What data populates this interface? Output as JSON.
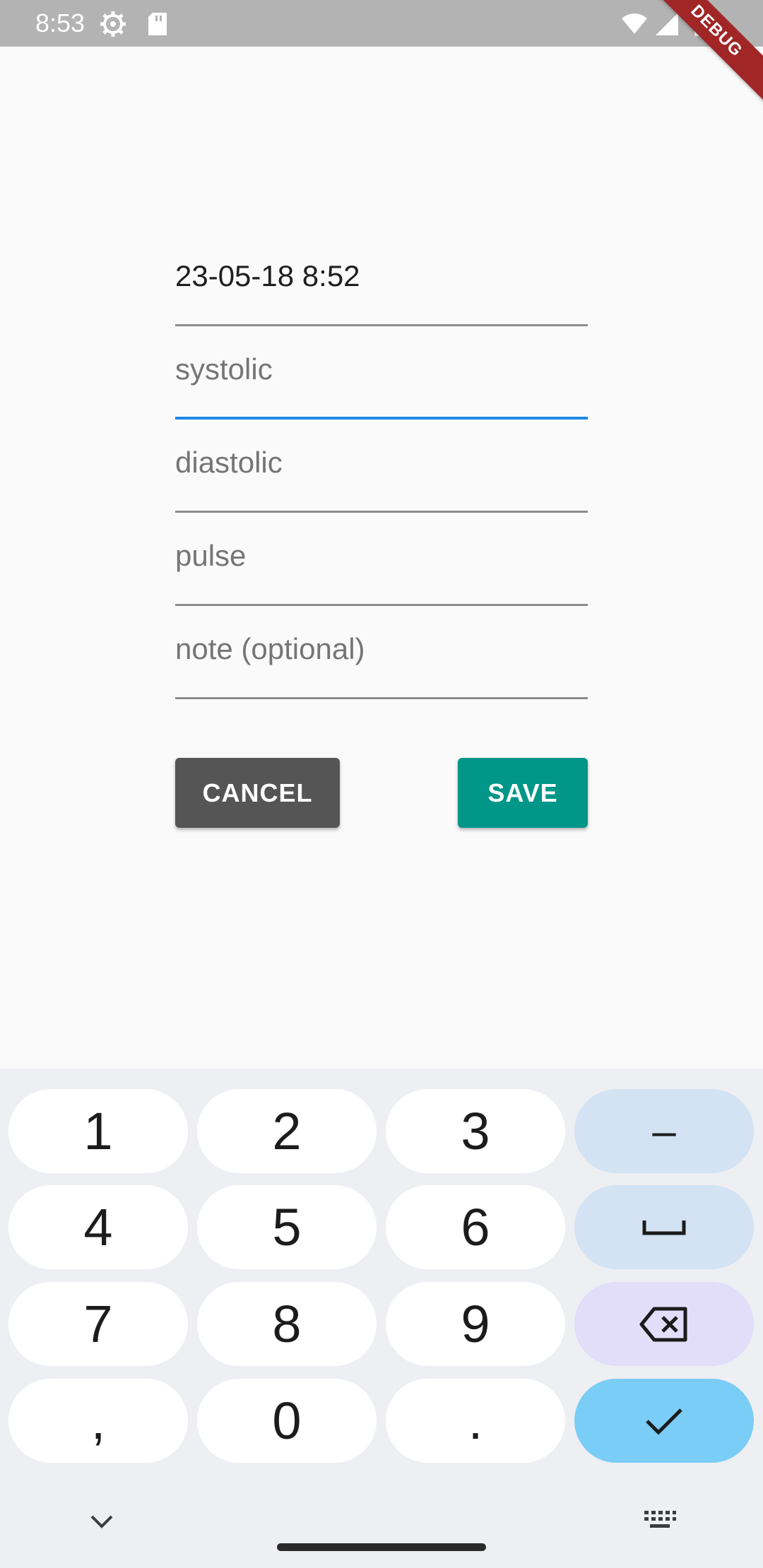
{
  "status_bar": {
    "time": "8:53",
    "icons": [
      "settings-icon",
      "sd-card-icon",
      "wifi-icon",
      "signal-icon",
      "battery-icon"
    ]
  },
  "debug_banner": {
    "label": "DEBUG",
    "color": "#a12626"
  },
  "form": {
    "datetime": {
      "value": "23-05-18 8:52"
    },
    "systolic": {
      "placeholder": "systolic",
      "focused": true
    },
    "diastolic": {
      "placeholder": "diastolic"
    },
    "pulse": {
      "placeholder": "pulse"
    },
    "note": {
      "placeholder": "note (optional)"
    }
  },
  "buttons": {
    "cancel": {
      "label": "CANCEL",
      "color": "#555555"
    },
    "save": {
      "label": "SAVE",
      "color": "#009688"
    }
  },
  "colors": {
    "focus_underline": "#1e88e5",
    "background": "#fafafa"
  },
  "keyboard": {
    "rows": [
      [
        "1",
        "2",
        "3",
        "–"
      ],
      [
        "4",
        "5",
        "6",
        "space"
      ],
      [
        "7",
        "8",
        "9",
        "backspace"
      ],
      [
        ",",
        "0",
        ".",
        "done"
      ]
    ],
    "key_labels": {
      "k1": "1",
      "k2": "2",
      "k3": "3",
      "minus": "–",
      "k4": "4",
      "k5": "5",
      "k6": "6",
      "k7": "7",
      "k8": "8",
      "k9": "9",
      "comma": ",",
      "k0": "0",
      "period": "."
    },
    "icons": [
      "space-icon",
      "backspace-icon",
      "checkmark-icon",
      "chevron-down-icon",
      "keyboard-icon"
    ]
  }
}
